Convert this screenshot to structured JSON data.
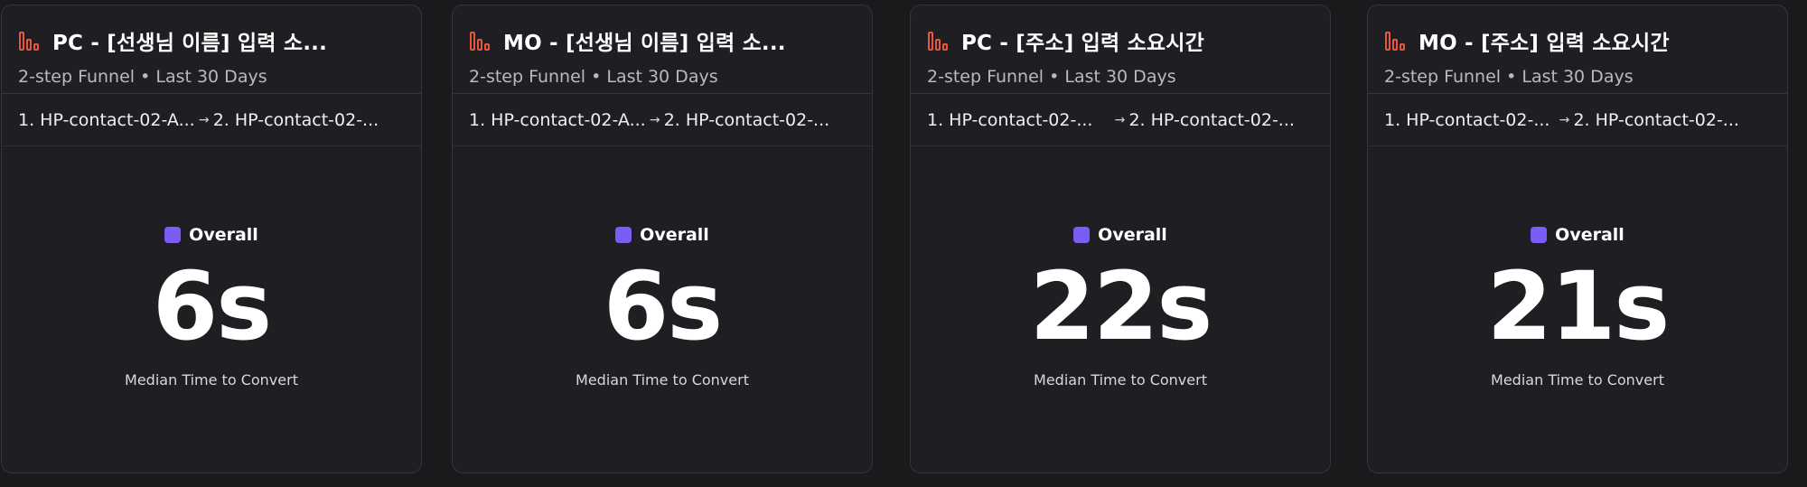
{
  "colors": {
    "background": "#1a1a1d",
    "card": "#1f1f23",
    "accent_icon": "#e8573d",
    "legend_swatch": "#7b5cf5"
  },
  "icons": {
    "card_icon": "funnel-chart-icon",
    "arrow": "arrow-right-icon"
  },
  "cards": [
    {
      "title": "PC - [선생님 이름] 입력 소...",
      "subtitle": "2-step Funnel • Last 30 Days",
      "step1": "1. HP-contact-02-A...",
      "step2": "2. HP-contact-02-...",
      "legend": "Overall",
      "value": "6s",
      "caption": "Median Time to Convert"
    },
    {
      "title": "MO - [선생님 이름] 입력 소...",
      "subtitle": "2-step Funnel • Last 30 Days",
      "step1": "1. HP-contact-02-A...",
      "step2": "2. HP-contact-02-...",
      "legend": "Overall",
      "value": "6s",
      "caption": "Median Time to Convert"
    },
    {
      "title": "PC - [주소] 입력 소요시간",
      "subtitle": "2-step Funnel • Last 30 Days",
      "step1": "1. HP-contact-02-...",
      "step2": "2. HP-contact-02-...",
      "legend": "Overall",
      "value": "22s",
      "caption": "Median Time to Convert"
    },
    {
      "title": "MO - [주소] 입력 소요시간",
      "subtitle": "2-step Funnel • Last 30 Days",
      "step1": "1. HP-contact-02-...",
      "step2": "2. HP-contact-02-...",
      "legend": "Overall",
      "value": "21s",
      "caption": "Median Time to Convert"
    }
  ]
}
